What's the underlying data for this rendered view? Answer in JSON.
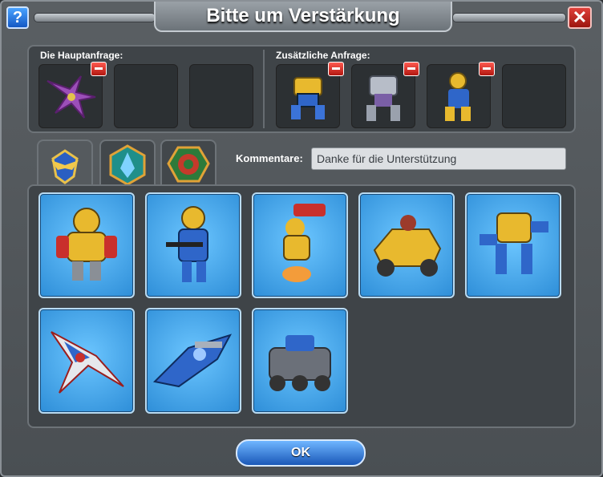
{
  "window": {
    "title": "Bitte um Verstärkung",
    "help_icon": "question-mark-icon",
    "close_icon": "close-x-icon"
  },
  "requests": {
    "main_label": "Die Hauptanfrage:",
    "extra_label": "Zusätzliche Anfrage:",
    "main_slots": [
      {
        "unit": "purple-dragon-icon",
        "removable": true
      },
      {
        "unit": "",
        "removable": false
      },
      {
        "unit": "",
        "removable": false
      }
    ],
    "extra_slots": [
      {
        "unit": "yellow-blue-mech-icon",
        "removable": true
      },
      {
        "unit": "silver-mech-icon",
        "removable": true
      },
      {
        "unit": "jetpack-trooper-icon",
        "removable": true
      },
      {
        "unit": "",
        "removable": false
      }
    ]
  },
  "tabs": [
    {
      "icon": "eagle-emblem-icon",
      "active": true
    },
    {
      "icon": "blue-crystal-emblem-icon",
      "active": false
    },
    {
      "icon": "green-spiral-emblem-icon",
      "active": false
    }
  ],
  "comment": {
    "label": "Kommentare:",
    "value": "Danke für die Unterstützung"
  },
  "units": [
    {
      "icon": "heavy-armor-trooper-icon"
    },
    {
      "icon": "rifle-trooper-icon"
    },
    {
      "icon": "rocket-jetpack-trooper-icon"
    },
    {
      "icon": "yellow-buggy-vehicle-icon"
    },
    {
      "icon": "walker-mech-icon"
    },
    {
      "icon": "red-white-fighter-jet-icon"
    },
    {
      "icon": "blue-gunship-icon"
    },
    {
      "icon": "armored-tank-icon"
    }
  ],
  "ok_label": "OK",
  "colors": {
    "card_blue": "#3a9ae6",
    "remove_red": "#d2241c",
    "ok_blue": "#2f7be0"
  }
}
